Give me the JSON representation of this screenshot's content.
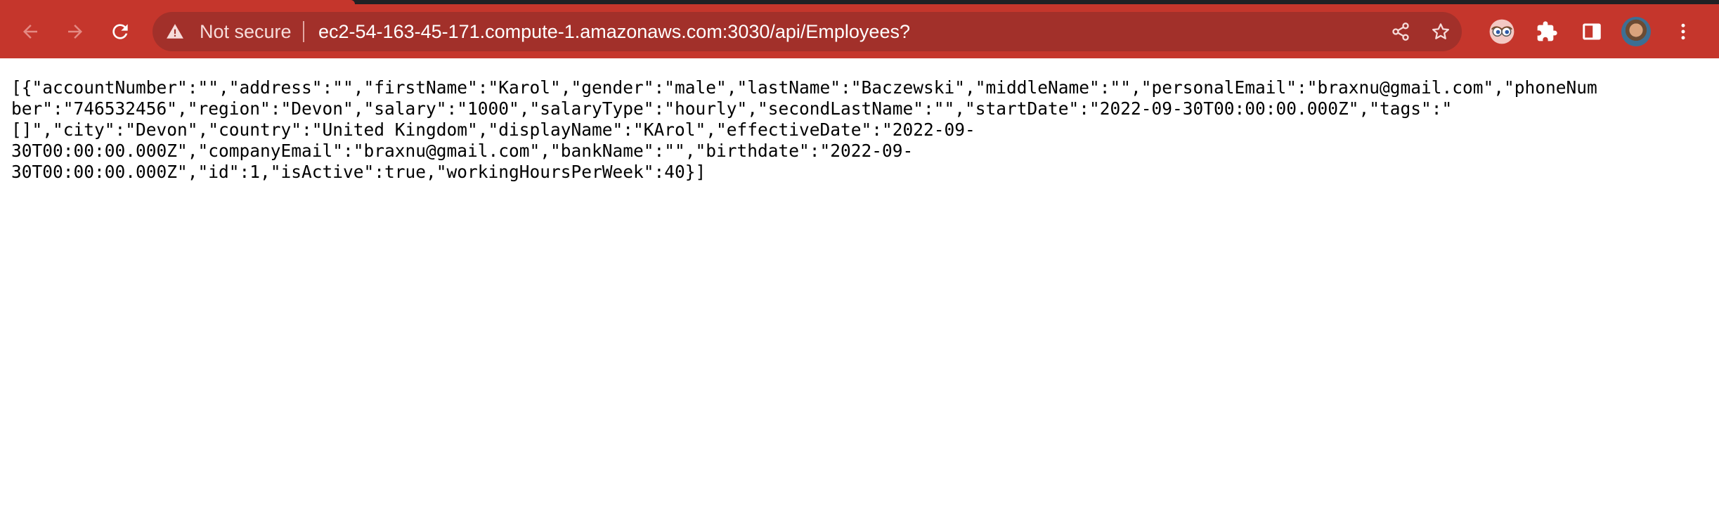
{
  "browser": {
    "security_label": "Not secure",
    "url": "ec2-54-163-45-171.compute-1.amazonaws.com:3030/api/Employees?",
    "colors": {
      "toolbar": "#c5362c",
      "omnibox": "#a2302a",
      "text": "#ffffff"
    },
    "icons": {
      "back": "arrow-left-icon",
      "forward": "arrow-right-icon",
      "reload": "reload-icon",
      "warning": "warning-triangle-icon",
      "share": "share-icon",
      "bookmark": "star-icon",
      "extension": "eyes-extension-icon",
      "extensions": "puzzle-icon",
      "side_panel": "side-panel-icon",
      "profile": "avatar",
      "menu": "kebab-menu-icon"
    }
  },
  "page": {
    "lines": [
      "[{\"accountNumber\":\"\",\"address\":\"\",\"firstName\":\"Karol\",\"gender\":\"male\",\"lastName\":\"Baczewski\",\"middleName\":\"\",\"personalEmail\":\"braxnu@gmail.com\",\"phoneNum",
      "ber\":\"746532456\",\"region\":\"Devon\",\"salary\":\"1000\",\"salaryType\":\"hourly\",\"secondLastName\":\"\",\"startDate\":\"2022-09-30T00:00:00.000Z\",\"tags\":\"",
      "[]\",\"city\":\"Devon\",\"country\":\"United Kingdom\",\"displayName\":\"KArol\",\"effectiveDate\":\"2022-09-",
      "30T00:00:00.000Z\",\"companyEmail\":\"braxnu@gmail.com\",\"bankName\":\"\",\"birthdate\":\"2022-09-",
      "30T00:00:00.000Z\",\"id\":1,\"isActive\":true,\"workingHoursPerWeek\":40}]"
    ]
  }
}
